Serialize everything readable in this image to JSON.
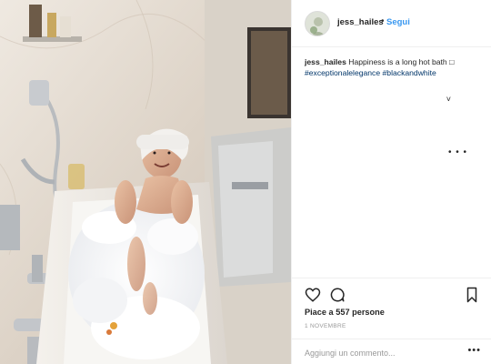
{
  "post": {
    "image_alt": "woman in bathtub with foam",
    "header": {
      "username": "jess_hailes",
      "separator": "•",
      "follow_label": "Segui"
    },
    "caption": {
      "username": "jess_hailes",
      "text": "Happiness is a long hot bath",
      "emoji": "□",
      "hashtags": [
        "#exceptionalelegance",
        "#blackandwhite"
      ]
    },
    "more_small": "˅",
    "more_dots": "• • •",
    "likes": "Piace a 557 persone",
    "date": "1 NOVEMBRE",
    "comment": {
      "placeholder": "Aggiungi un commento...",
      "more": "•••"
    },
    "icons": {
      "heart": "heart-icon",
      "comment": "comment-icon",
      "bookmark": "bookmark-icon"
    },
    "colors": {
      "link": "#3897f0",
      "hashtag": "#003569",
      "text": "#262626",
      "muted": "#999999",
      "border": "#efefef"
    }
  }
}
